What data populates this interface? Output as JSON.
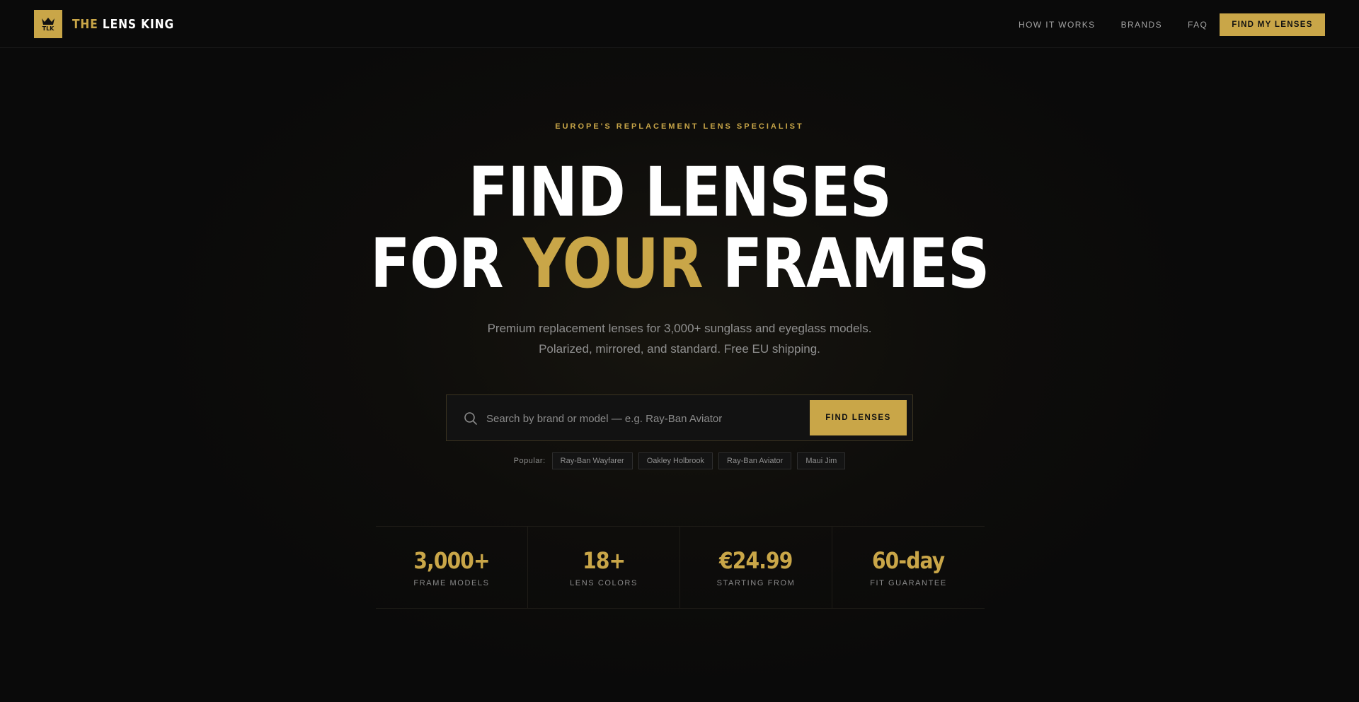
{
  "brand": {
    "logo_mark": "TLK",
    "name_prefix": "THE",
    "name_rest": "LENS KING",
    "accent_color": "#c9a648"
  },
  "nav": {
    "links": [
      {
        "label": "HOW IT WORKS"
      },
      {
        "label": "BRANDS"
      },
      {
        "label": "FAQ"
      }
    ],
    "cta_label": "FIND MY LENSES"
  },
  "hero": {
    "eyebrow": "EUROPE'S REPLACEMENT LENS SPECIALIST",
    "headline_line1": "FIND LENSES",
    "headline_line2_pre": "FOR ",
    "headline_line2_accent": "YOUR",
    "headline_line2_post": " FRAMES",
    "subtitle": "Premium replacement lenses for 3,000+ sunglass and eyeglass models. Polarized, mirrored, and standard. Free EU shipping."
  },
  "search": {
    "placeholder": "Search by brand or model — e.g. Ray-Ban Aviator",
    "value": "",
    "button_label": "FIND LENSES",
    "icon": "search-icon"
  },
  "popular": {
    "label": "Popular:",
    "chips": [
      {
        "label": "Ray-Ban Wayfarer"
      },
      {
        "label": "Oakley Holbrook"
      },
      {
        "label": "Ray-Ban Aviator"
      },
      {
        "label": "Maui Jim"
      }
    ]
  },
  "stats": [
    {
      "value": "3,000+",
      "label": "FRAME MODELS"
    },
    {
      "value": "18+",
      "label": "LENS COLORS"
    },
    {
      "value": "€24.99",
      "label": "STARTING FROM"
    },
    {
      "value": "60-day",
      "label": "FIT GUARANTEE"
    }
  ]
}
